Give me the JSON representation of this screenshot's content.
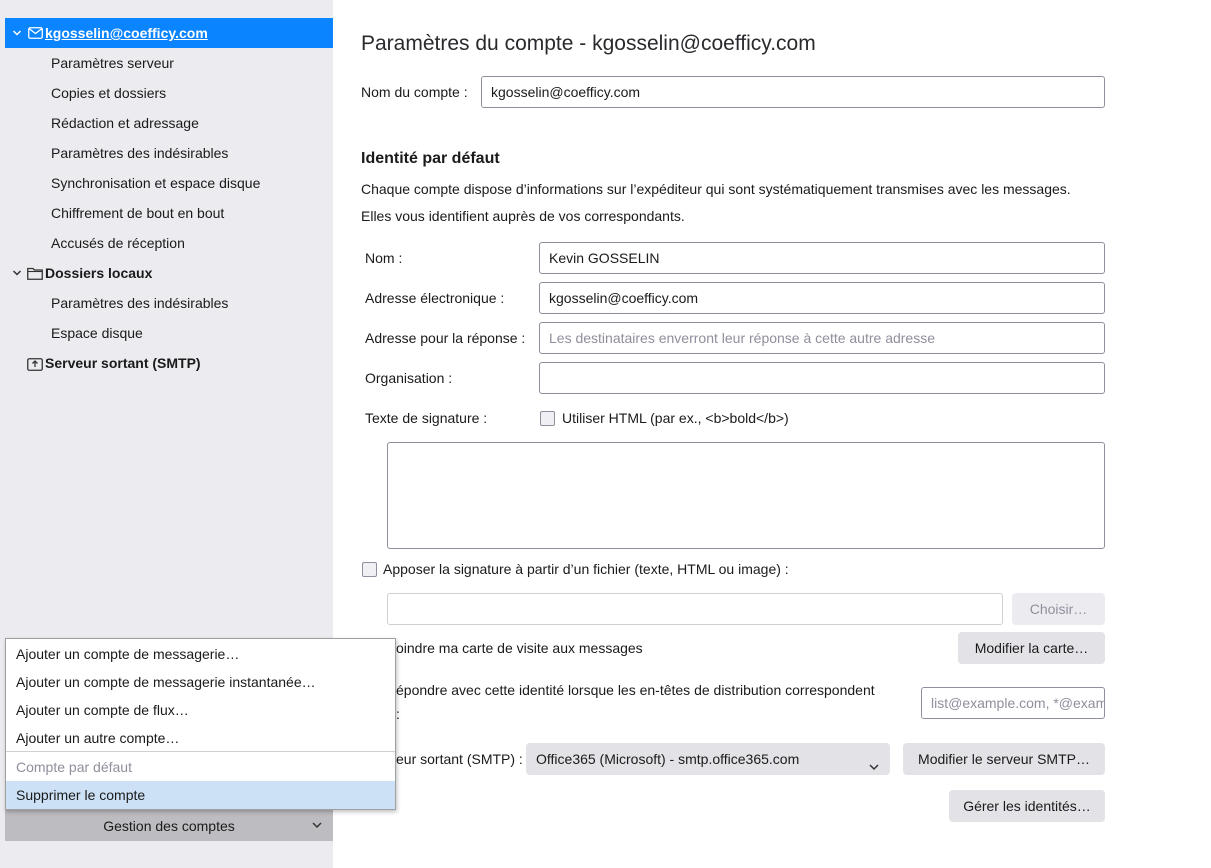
{
  "sidebar": {
    "accounts": [
      {
        "label": "kgosselin@coefficy.com",
        "icon": "mail-icon",
        "children": [
          "Paramètres serveur",
          "Copies et dossiers",
          "Rédaction et adressage",
          "Paramètres des indésirables",
          "Synchronisation et espace disque",
          "Chiffrement de bout en bout",
          "Accusés de réception"
        ]
      },
      {
        "label": "Dossiers locaux",
        "icon": "folder-icon",
        "children": [
          "Paramètres des indésirables",
          "Espace disque"
        ]
      },
      {
        "label": "Serveur sortant (SMTP)",
        "icon": "outbox-icon"
      }
    ],
    "manage_button": "Gestion des comptes",
    "colors": {
      "selected_bg": "#0a84ff",
      "sidebar_bg": "#ececf0"
    }
  },
  "menu": {
    "items": [
      "Ajouter un compte de messagerie…",
      "Ajouter un compte de messagerie instantanée…",
      "Ajouter un compte de flux…",
      "Ajouter un autre compte…",
      "Compte par défaut",
      "Supprimer le compte"
    ],
    "disabled_item": "Compte par défaut",
    "highlighted_item": "Supprimer le compte"
  },
  "main": {
    "title": "Paramètres du compte - kgosselin@coefficy.com",
    "account_name_label": "Nom du compte :",
    "account_name_value": "kgosselin@coefficy.com",
    "identity_title": "Identité par défaut",
    "identity_desc_1": "Chaque compte dispose d’informations sur l’expéditeur qui sont systématiquement transmises avec les messages.",
    "identity_desc_2": "Elles vous identifient auprès de vos correspondants.",
    "name_label": "Nom :",
    "name_value": "Kevin GOSSELIN",
    "email_label": "Adresse électronique :",
    "email_value": "kgosselin@coefficy.com",
    "reply_label": "Adresse pour la réponse :",
    "reply_placeholder": "Les destinataires enverront leur réponse à cette autre adresse",
    "org_label": "Organisation :",
    "org_value": "",
    "signature_label": "Texte de signature :",
    "use_html_label": "Utiliser HTML (par ex., <b>bold</b>)",
    "signature_text": "",
    "attach_sig_label": "Apposer la signature à partir d’un fichier (texte, HTML ou image) :",
    "sig_file_value": "",
    "choose_button": "Choisir…",
    "vcard_label": "Joindre ma carte de visite aux messages",
    "vcard_label_visible": "oindre ma carte de visite aux messages",
    "edit_card_button": "Modifier la carte…",
    "reply_identity_label_visible": "épondre avec cette identité lorsque les en-têtes de distribution correspondent",
    "reply_identity_colon": ":",
    "reply_identity_placeholder": "list@example.com, *@example.com",
    "smtp_label_visible": "eur sortant (SMTP) :",
    "smtp_value": "Office365 (Microsoft) - smtp.office365.com",
    "edit_smtp_button": "Modifier le serveur SMTP…",
    "manage_identities_button": "Gérer les identités…"
  }
}
